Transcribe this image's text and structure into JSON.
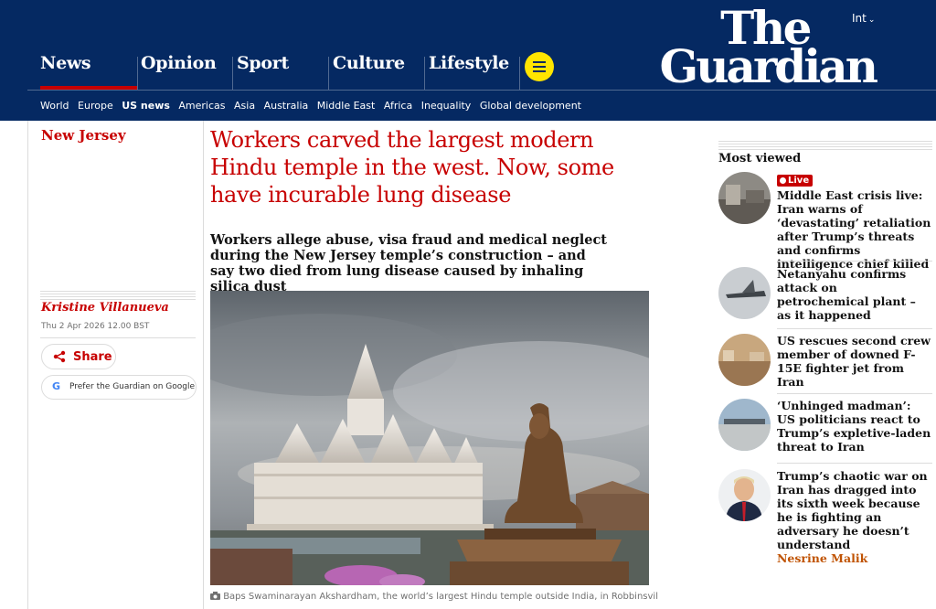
{
  "header": {
    "pillars": [
      "News",
      "Opinion",
      "Sport",
      "Culture",
      "Lifestyle"
    ],
    "active_pillar": "News",
    "edition": "Int",
    "logo_line1": "The",
    "logo_line2": "Guardian",
    "subnav": [
      "World",
      "Europe",
      "US news",
      "Americas",
      "Asia",
      "Australia",
      "Middle East",
      "Africa",
      "Inequality",
      "Global development"
    ],
    "active_subnav": "US news"
  },
  "article": {
    "kicker": "New Jersey",
    "headline": "Workers carved the largest modern Hindu temple in the west. Now, some have incurable lung disease",
    "standfirst": "Workers allege abuse, visa fraud and medical neglect during the New Jersey temple’s construction – and say two died from lung disease caused by inhaling silica dust",
    "byline": "Kristine Villanueva",
    "date": "Thu 2 Apr 2026 12.00 BST",
    "share_label": "Share",
    "google_label": "Prefer the Guardian on Google",
    "caption": "Baps Swaminarayan Akshardham, the world’s largest Hindu temple outside India, in Robbinsville"
  },
  "most_viewed": {
    "title": "Most viewed",
    "live_label": "Live",
    "items": [
      {
        "text": "Middle East crisis live: Iran warns of ‘devastating’ retaliation after Trump’s threats and confirms intelligence chief killed",
        "live": true,
        "author": ""
      },
      {
        "text": "Netanyahu confirms attack on petrochemical plant – as it happened",
        "live": false,
        "author": ""
      },
      {
        "text": "US rescues second crew member of downed F-15E fighter jet from Iran",
        "live": false,
        "author": ""
      },
      {
        "text": "‘Unhinged madman’: US politicians react to Trump’s expletive-laden threat to Iran",
        "live": false,
        "author": ""
      },
      {
        "text": "Trump’s chaotic war on Iran has dragged into its sixth week because he is fighting an adversary he doesn’t understand",
        "live": false,
        "author": "Nesrine Malik"
      }
    ]
  },
  "colors": {
    "brand": "#052962",
    "news_red": "#c70000",
    "menu_yellow": "#ffe500",
    "opinion_orange": "#c05303"
  },
  "icons": [
    "menu-icon",
    "chevron-down-icon",
    "share-icon",
    "google-icon",
    "camera-icon"
  ]
}
